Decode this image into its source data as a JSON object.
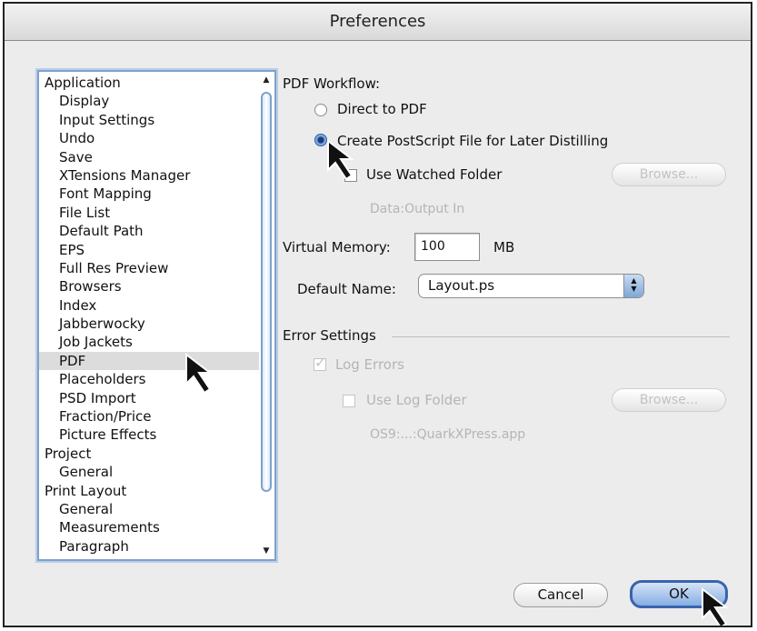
{
  "window": {
    "title": "Preferences"
  },
  "sidebar": {
    "items": [
      {
        "label": "Application",
        "level": 0
      },
      {
        "label": "Display",
        "level": 1
      },
      {
        "label": "Input Settings",
        "level": 1
      },
      {
        "label": "Undo",
        "level": 1
      },
      {
        "label": "Save",
        "level": 1
      },
      {
        "label": "XTensions Manager",
        "level": 1
      },
      {
        "label": "Font Mapping",
        "level": 1
      },
      {
        "label": "File List",
        "level": 1
      },
      {
        "label": "Default Path",
        "level": 1
      },
      {
        "label": "EPS",
        "level": 1
      },
      {
        "label": "Full Res Preview",
        "level": 1
      },
      {
        "label": "Browsers",
        "level": 1
      },
      {
        "label": "Index",
        "level": 1
      },
      {
        "label": "Jabberwocky",
        "level": 1
      },
      {
        "label": "Job Jackets",
        "level": 1
      },
      {
        "label": "PDF",
        "level": 1,
        "selected": true
      },
      {
        "label": "Placeholders",
        "level": 1
      },
      {
        "label": "PSD Import",
        "level": 1
      },
      {
        "label": "Fraction/Price",
        "level": 1
      },
      {
        "label": "Picture Effects",
        "level": 1
      },
      {
        "label": "Project",
        "level": 0
      },
      {
        "label": "General",
        "level": 1
      },
      {
        "label": "Print Layout",
        "level": 0
      },
      {
        "label": "General",
        "level": 1
      },
      {
        "label": "Measurements",
        "level": 1
      },
      {
        "label": "Paragraph",
        "level": 1
      }
    ]
  },
  "pdf_workflow": {
    "heading": "PDF Workflow:",
    "direct_label": "Direct to PDF",
    "postscript_label": "Create PostScript File for Later Distilling",
    "selected": "postscript",
    "watched_folder_label": "Use Watched Folder",
    "watched_folder_checked": false,
    "browse_label": "Browse...",
    "folder_path": "Data:Output In"
  },
  "virtual_memory": {
    "label": "Virtual Memory:",
    "value": "100",
    "unit": "MB"
  },
  "default_name": {
    "label": "Default Name:",
    "value": "Layout.ps"
  },
  "error_settings": {
    "heading": "Error Settings",
    "log_errors_label": "Log Errors",
    "log_errors_checked": true,
    "use_log_folder_label": "Use Log Folder",
    "use_log_folder_checked": false,
    "browse_label": "Browse...",
    "log_path": "OS9:...:QuarkXPress.app"
  },
  "buttons": {
    "cancel": "Cancel",
    "ok": "OK"
  },
  "colors": {
    "accent": "#3a63ad",
    "selection": "#dcdcdc",
    "disabled_text": "#b5b5b5"
  }
}
